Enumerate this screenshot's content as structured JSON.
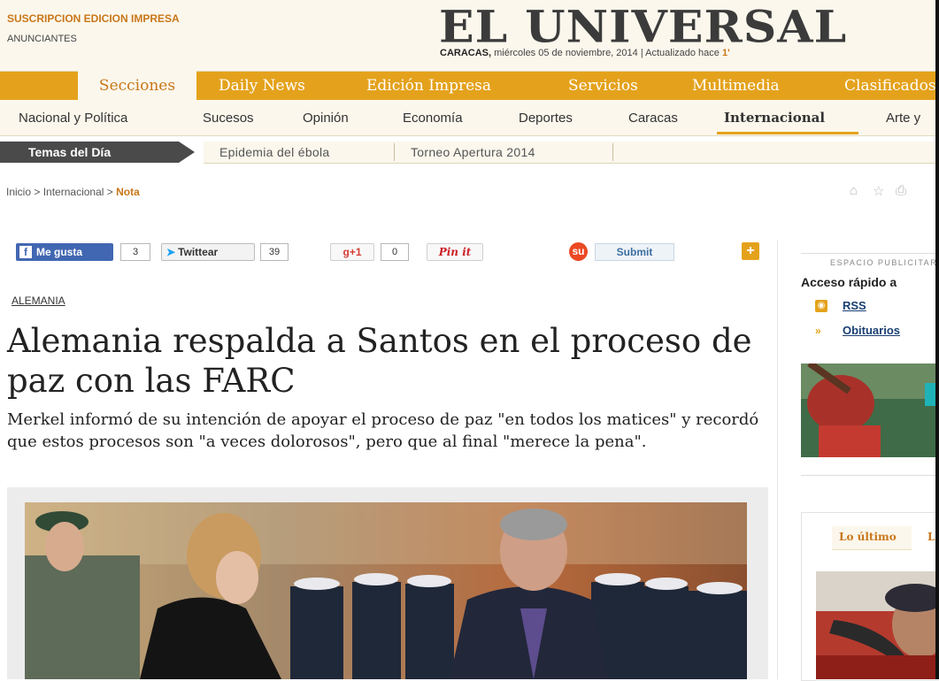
{
  "header": {
    "subscribe_link": "SUSCRIPCION EDICION IMPRESA",
    "advertisers_link": "ANUNCIANTES",
    "logo": "EL UNIVERSAL",
    "date_city": "CARACAS,",
    "date_text": " miércoles 05 de noviembre, 2014 | Actualizado hace ",
    "updated_value": "1'"
  },
  "sections": [
    {
      "label": "Secciones"
    },
    {
      "label": "Daily News"
    },
    {
      "label": "Edición Impresa"
    },
    {
      "label": "Servicios"
    },
    {
      "label": "Multimedia"
    },
    {
      "label": "Clasificados"
    }
  ],
  "categories": [
    {
      "label": "Nacional y Política"
    },
    {
      "label": "Sucesos"
    },
    {
      "label": "Opinión"
    },
    {
      "label": "Economía"
    },
    {
      "label": "Deportes"
    },
    {
      "label": "Caracas"
    },
    {
      "label": "Internacional"
    },
    {
      "label": "Arte y"
    }
  ],
  "temas": {
    "label": "Temas del Día",
    "items": [
      {
        "label": "Epidemia del ébola"
      },
      {
        "label": "Torneo Apertura 2014"
      }
    ]
  },
  "breadcrumb": {
    "home": "Inicio",
    "sep": ">",
    "section": "Internacional",
    "current": "Nota"
  },
  "social": {
    "fb_label": "Me gusta",
    "fb_count": "3",
    "tw_label": "Twittear",
    "tw_count": "39",
    "gplus_label": "+1",
    "gplus_count": "0",
    "pin_label": "Pin it",
    "submit_label": "Submit",
    "plus_label": "+"
  },
  "article": {
    "kicker": "ALEMANIA",
    "headline": "Alemania respalda a Santos en el proceso de paz con las FARC",
    "dek": "Merkel informó de su intención de apoyar el proceso de paz \"en todos los matices\" y recordó que estos procesos son \"a veces dolorosos\", pero que al final \"merece la pena\"."
  },
  "sidebar": {
    "ad_label": "ESPACIO PUBLICITARIO",
    "quick_access": "Acceso rápido a",
    "rss": "RSS",
    "obituaries": "Obituarios",
    "tab_latest": "Lo último",
    "tab_next": "L"
  },
  "colors": {
    "brand_orange": "#e4a21c",
    "accent_text": "#c8771a",
    "cream": "#fbf7ec",
    "temas_dark": "#4a4a4a",
    "facebook": "#4267b2"
  },
  "icons": [
    "home-icon",
    "star-icon",
    "print-icon",
    "facebook-icon",
    "twitter-bird-icon",
    "google-plus-icon",
    "pinterest-icon",
    "stumbleupon-icon",
    "plus-icon",
    "rss-icon",
    "double-chevron-icon"
  ]
}
